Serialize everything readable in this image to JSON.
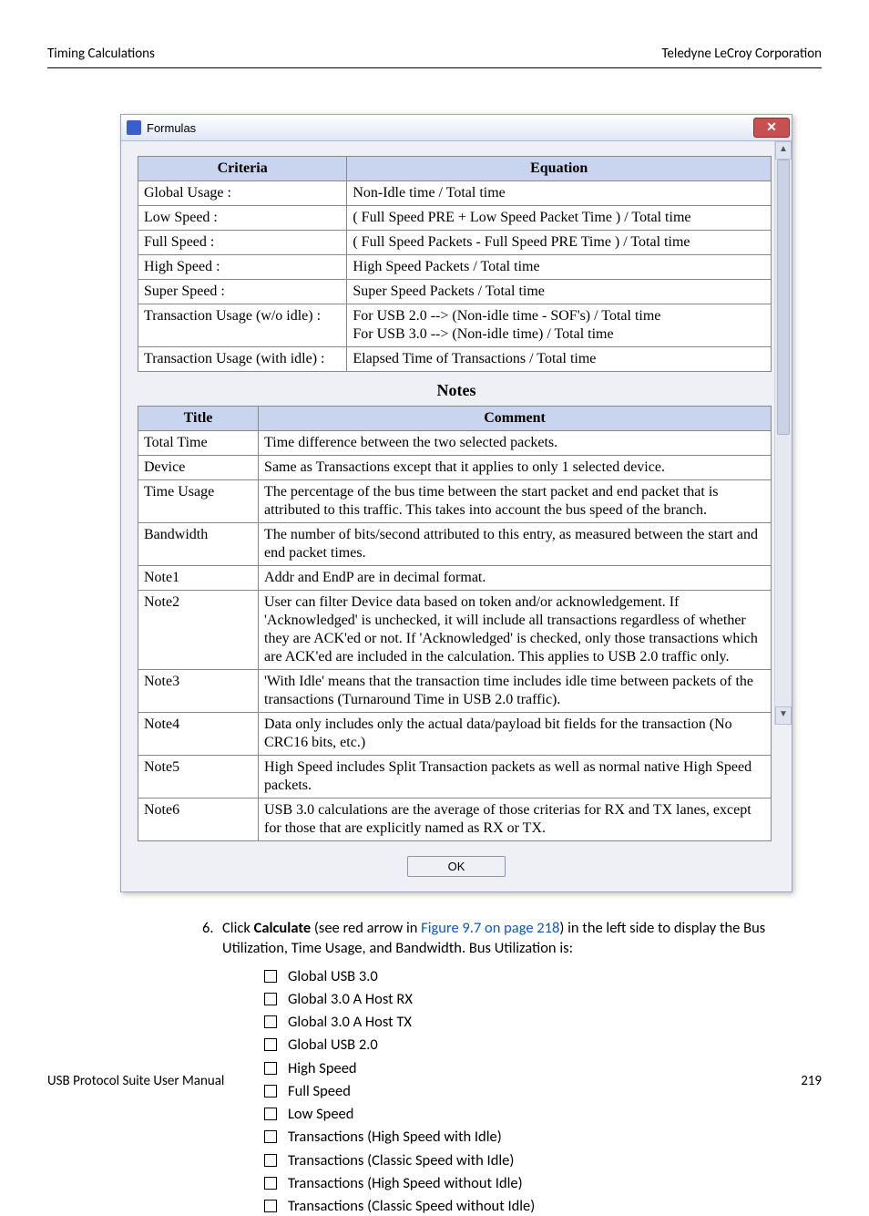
{
  "header": {
    "left": "Timing Calculations",
    "right": "Teledyne LeCroy Corporation"
  },
  "footer": {
    "left": "USB Protocol Suite User Manual",
    "right": "219"
  },
  "dialog": {
    "title": "Formulas",
    "ok": "OK",
    "criteria_hdr": "Criteria",
    "equation_hdr": "Equation",
    "rows": [
      {
        "c": "Global Usage :",
        "e": "Non-Idle time / Total time"
      },
      {
        "c": "Low Speed :",
        "e": "( Full Speed PRE + Low Speed Packet Time ) / Total time"
      },
      {
        "c": "Full Speed :",
        "e": "( Full Speed Packets - Full Speed PRE Time ) / Total time"
      },
      {
        "c": "High Speed :",
        "e": "High Speed Packets / Total time"
      },
      {
        "c": "Super Speed :",
        "e": "Super Speed Packets / Total time"
      },
      {
        "c": "Transaction Usage (w/o idle) :",
        "e": "For USB 2.0 --> (Non-idle time - SOF's) / Total time\nFor USB 3.0 --> (Non-idle time) / Total time"
      },
      {
        "c": "Transaction Usage (with idle) :",
        "e": "Elapsed Time of Transactions / Total time"
      }
    ],
    "notes_hdr": "Notes",
    "title_hdr": "Title",
    "comment_hdr": "Comment",
    "notes": [
      {
        "t": "Total Time",
        "c": "Time difference between the two selected packets."
      },
      {
        "t": "Device",
        "c": "Same as Transactions except that it applies to only 1 selected device."
      },
      {
        "t": "Time Usage",
        "c": "The percentage of the bus time between the start packet and end packet that is attributed to this traffic. This takes into account the bus speed of the branch."
      },
      {
        "t": "Bandwidth",
        "c": "The number of bits/second attributed to this entry, as measured between the start and end packet times."
      },
      {
        "t": "Note1",
        "c": "Addr and EndP are in decimal format."
      },
      {
        "t": "Note2",
        "c": "User can filter Device data based on token and/or acknowledgement. If 'Acknowledged' is unchecked, it will include all transactions regardless of whether they are ACK'ed or not. If 'Acknowledged' is checked, only those transactions which are ACK'ed are included in the calculation. This applies to USB 2.0 traffic only."
      },
      {
        "t": "Note3",
        "c": "'With Idle' means that the transaction time includes idle time between packets of the transactions (Turnaround Time in USB 2.0 traffic)."
      },
      {
        "t": "Note4",
        "c": "Data only includes only the actual data/payload bit fields for the transaction (No CRC16 bits, etc.)"
      },
      {
        "t": "Note5",
        "c": "High Speed includes Split Transaction packets as well as normal native High Speed packets."
      },
      {
        "t": "Note6",
        "c": "USB 3.0 calculations are the average of those criterias for RX and TX lanes, except for those that are explicitly named as RX or TX."
      }
    ]
  },
  "step": {
    "n": "6.",
    "pre": "Click ",
    "b": "Calculate",
    "mid": " (see red arrow in ",
    "link": "Figure 9.7 on page 218",
    "post": ") in the left side to display the Bus Utilization, Time Usage, and Bandwidth. Bus Utilization is:"
  },
  "bullets": [
    "Global USB 3.0",
    "Global 3.0 A Host RX",
    "Global 3.0 A Host TX",
    "Global USB 2.0",
    "High Speed",
    "Full Speed",
    "Low Speed",
    "Transactions (High Speed with Idle)",
    "Transactions (Classic Speed with Idle)",
    "Transactions (High Speed without Idle)",
    "Transactions (Classic Speed without Idle)"
  ]
}
